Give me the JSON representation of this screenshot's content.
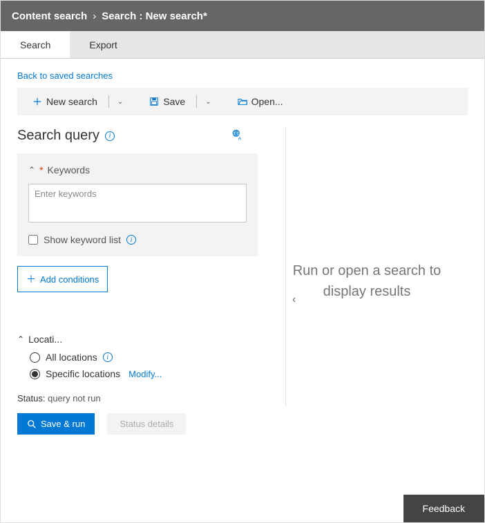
{
  "breadcrumb": {
    "item1": "Content search",
    "item2": "Search : New search*"
  },
  "tabs": [
    {
      "label": "Search",
      "active": true
    },
    {
      "label": "Export",
      "active": false
    }
  ],
  "back_link": "Back to saved searches",
  "toolbar": {
    "new_search": "New search",
    "save": "Save",
    "open": "Open..."
  },
  "search_query": {
    "title": "Search query",
    "keywords_label": "Keywords",
    "keywords_placeholder": "Enter keywords",
    "keywords_value": "",
    "show_keyword_list": "Show keyword list",
    "add_conditions": "Add conditions"
  },
  "locations": {
    "title": "Locati...",
    "all": "All locations",
    "specific": "Specific locations",
    "modify": "Modify...",
    "selected": "specific"
  },
  "status": {
    "label": "Status:",
    "value": "query not run"
  },
  "actions": {
    "save_run": "Save & run",
    "status_details": "Status details"
  },
  "results_placeholder": "Run or open a search to display results",
  "feedback": "Feedback"
}
